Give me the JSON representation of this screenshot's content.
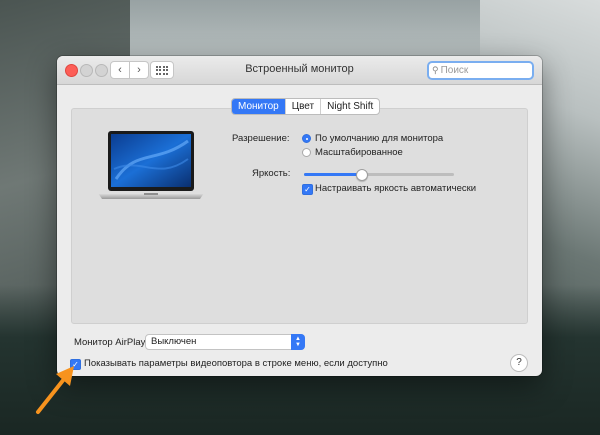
{
  "window": {
    "title": "Встроенный монитор",
    "search": {
      "placeholder": "Поиск"
    }
  },
  "tabs": [
    {
      "label": "Монитор",
      "active": true
    },
    {
      "label": "Цвет",
      "active": false
    },
    {
      "label": "Night Shift",
      "active": false
    }
  ],
  "resolution": {
    "label": "Разрешение:",
    "options": [
      {
        "label": "По умолчанию для монитора",
        "selected": true
      },
      {
        "label": "Масштабированное",
        "selected": false
      }
    ]
  },
  "brightness": {
    "label": "Яркость:",
    "value": 0.38,
    "auto_label": "Настраивать яркость автоматически",
    "auto_checked": true
  },
  "airplay": {
    "label": "Монитор AirPlay:",
    "value": "Выключен"
  },
  "mirroring": {
    "label": "Показывать параметры видеоповтора в строке меню, если доступно",
    "checked": true
  },
  "help": {
    "label": "?"
  },
  "icons": {
    "check": "✓",
    "back": "‹",
    "forward": "›",
    "search": "⚲",
    "select_up": "▲",
    "select_down": "▼"
  },
  "colors": {
    "accent": "#3478f6",
    "annotation_arrow": "#f7931e",
    "close": "#fd5e57"
  }
}
